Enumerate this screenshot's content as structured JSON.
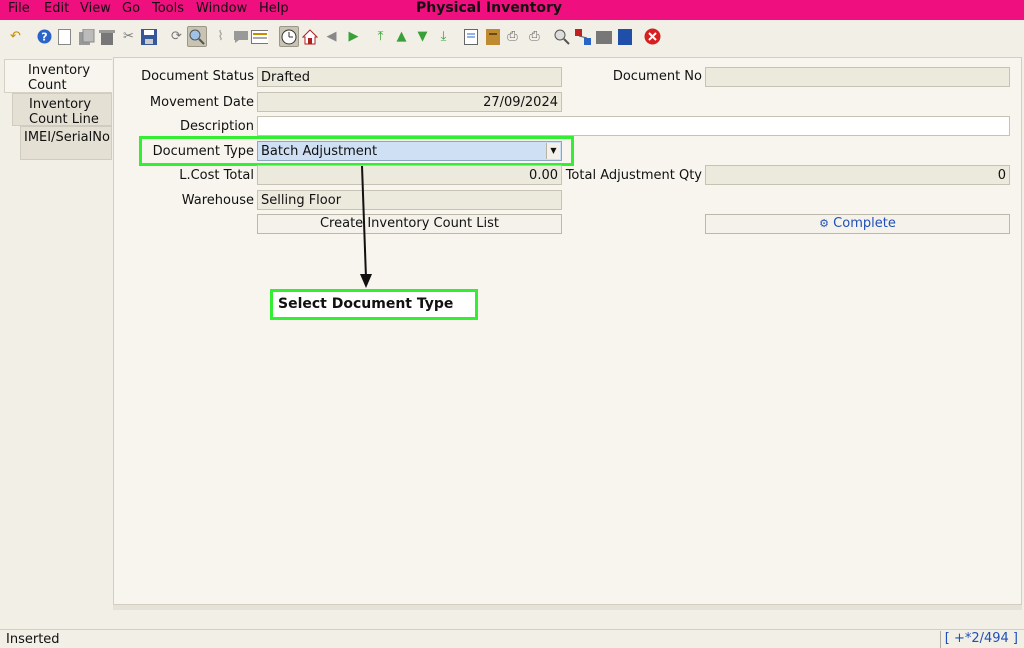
{
  "menu": {
    "items": [
      {
        "label": "File"
      },
      {
        "label": "Edit"
      },
      {
        "label": "View"
      },
      {
        "label": "Go"
      },
      {
        "label": "Tools"
      },
      {
        "label": "Window"
      },
      {
        "label": "Help"
      }
    ],
    "title": "Physical Inventory"
  },
  "toolbar": {
    "icons": [
      "undo-icon",
      "help-icon",
      "new-icon",
      "copy-icon",
      "delete-icon",
      "delete-selection-icon",
      "save-icon",
      "refresh-icon",
      "find-icon",
      "attachment-icon",
      "chat-icon",
      "grid-toggle-icon",
      "history-icon",
      "home-icon",
      "back-icon",
      "forward-icon",
      "first-record-icon",
      "previous-record-icon",
      "next-record-icon",
      "last-record-icon",
      "report-icon",
      "archive-icon",
      "print-preview-icon",
      "print-icon",
      "zoom-across-icon",
      "workflow-icon",
      "product-info-icon",
      "lock-icon",
      "close-window-icon"
    ]
  },
  "tabs": [
    {
      "label": "Inventory Count"
    },
    {
      "label": "Inventory Count Line"
    },
    {
      "label": "IMEI/SerialNo"
    }
  ],
  "form": {
    "document_status": {
      "label": "Document Status",
      "value": "Drafted"
    },
    "document_no": {
      "label": "Document No",
      "value": ""
    },
    "movement_date": {
      "label": "Movement Date",
      "value": "27/09/2024"
    },
    "description": {
      "label": "Description",
      "value": ""
    },
    "document_type": {
      "label": "Document Type",
      "value": "Batch Adjustment"
    },
    "lcost_total": {
      "label": "L.Cost Total",
      "value": "0.00"
    },
    "total_adjustment_qty": {
      "label": "Total Adjustment Qty",
      "value": "0"
    },
    "warehouse": {
      "label": "Warehouse",
      "value": "Selling Floor"
    },
    "create_list_button": "Create Inventory Count List",
    "complete_button": "Complete"
  },
  "annotation": {
    "callout_text": "Select Document Type",
    "highlight_color": "#33ee33"
  },
  "status": {
    "message": "Inserted",
    "record_info": "[ +*2/494 ]"
  },
  "colors": {
    "menubar": "#ef0f7f",
    "background": "#f2efe6",
    "accent_blue": "#1f4fb8"
  }
}
